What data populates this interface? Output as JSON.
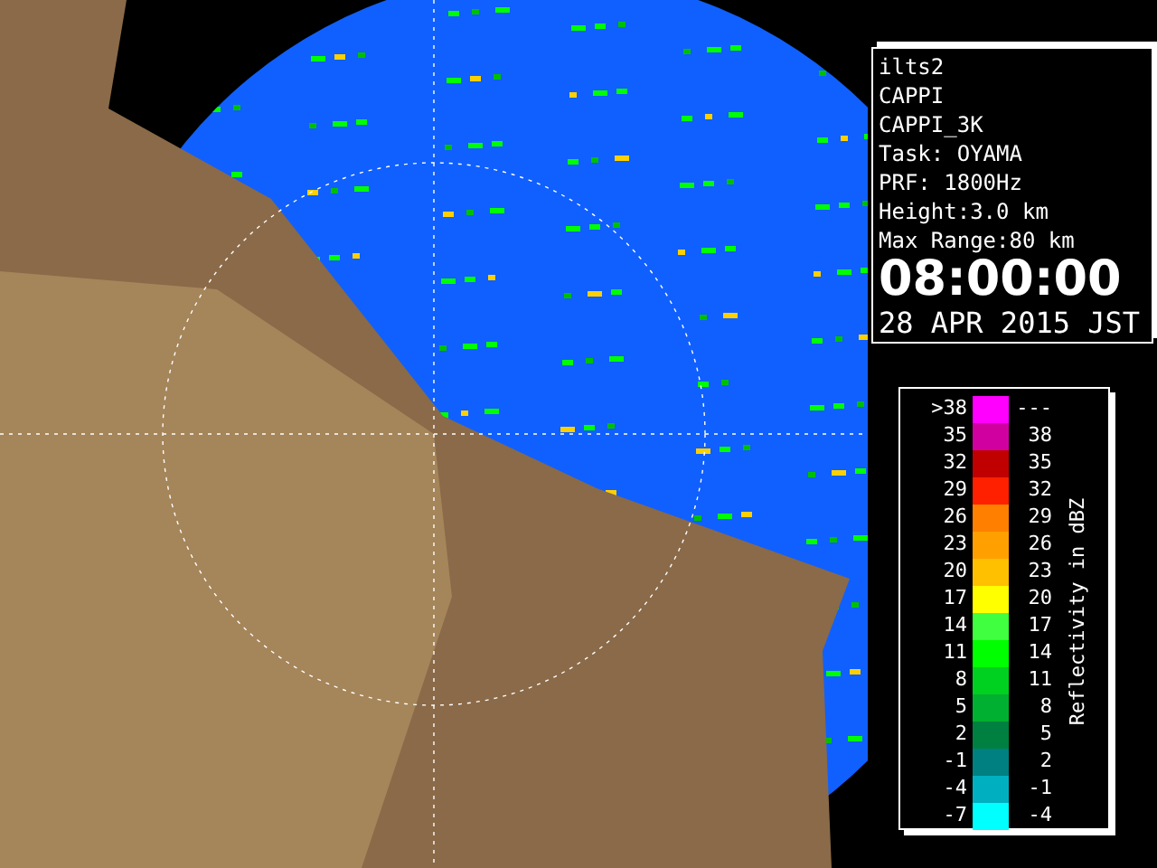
{
  "info": {
    "lines": [
      "ilts2",
      "CAPPI",
      "CAPPI_3K",
      "Task: OYAMA",
      "PRF: 1800Hz",
      "Height:3.0 km",
      "Max Range:80 km"
    ],
    "time": "08:00:00",
    "date": "28 APR 2015 JST"
  },
  "legend": {
    "title": "Reflectivity in dBZ",
    "rows": [
      {
        "low": ">38",
        "high": "---",
        "color": "#ff00ff"
      },
      {
        "low": "35",
        "high": "38",
        "color": "#d000a0"
      },
      {
        "low": "32",
        "high": "35",
        "color": "#c00000"
      },
      {
        "low": "29",
        "high": "32",
        "color": "#ff2000"
      },
      {
        "low": "26",
        "high": "29",
        "color": "#ff8000"
      },
      {
        "low": "23",
        "high": "26",
        "color": "#ffa000"
      },
      {
        "low": "20",
        "high": "23",
        "color": "#ffc000"
      },
      {
        "low": "17",
        "high": "20",
        "color": "#ffff00"
      },
      {
        "low": "14",
        "high": "17",
        "color": "#40ff40"
      },
      {
        "low": "11",
        "high": "14",
        "color": "#00ff00"
      },
      {
        "low": "8",
        "high": "11",
        "color": "#00d020"
      },
      {
        "low": "5",
        "high": "8",
        "color": "#00b030"
      },
      {
        "low": "2",
        "high": "5",
        "color": "#008040"
      },
      {
        "low": "-1",
        "high": "2",
        "color": "#008080"
      },
      {
        "low": "-4",
        "high": "-1",
        "color": "#00b0c0"
      },
      {
        "low": "-7",
        "high": "-4",
        "color": "#00ffff"
      }
    ]
  }
}
